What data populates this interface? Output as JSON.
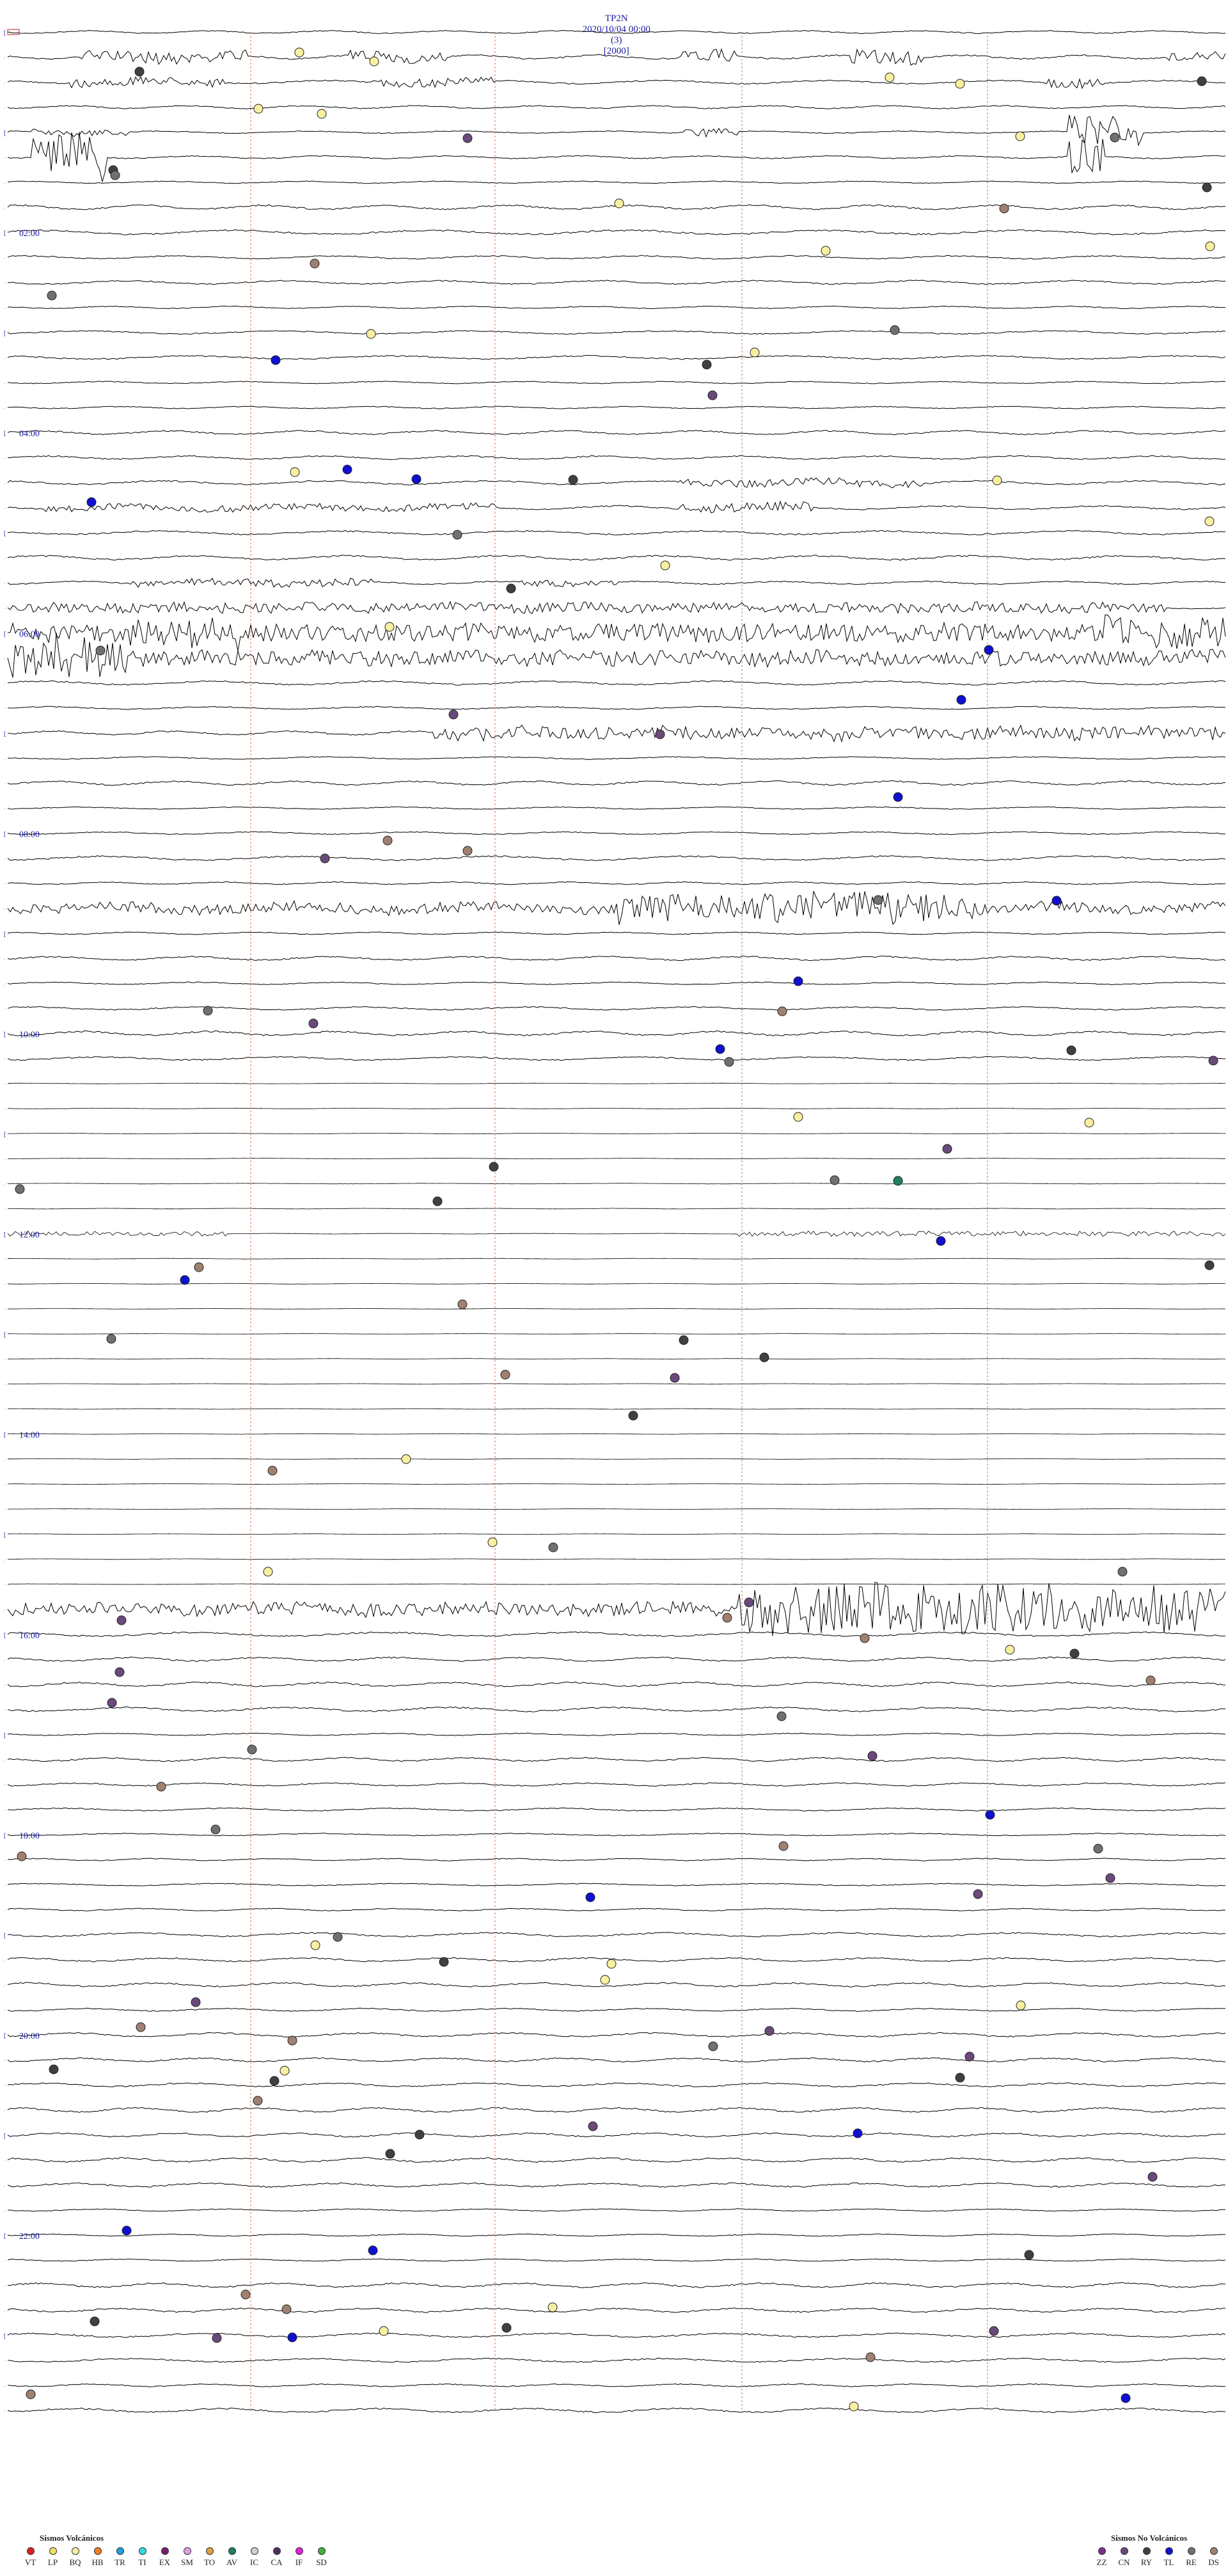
{
  "header": {
    "station": "TP2N",
    "datetime": "2020/10/04 00:00",
    "channel": "(3)",
    "scale": "[2000]"
  },
  "hour_labels": [
    "02:00",
    "04:00",
    "06:00",
    "08:00",
    "10:00",
    "12:00",
    "14:00",
    "16:00",
    "18:00",
    "20:00",
    "22:00"
  ],
  "legend_volcanic": {
    "title": "Sismos Volcánicos",
    "items": [
      {
        "code": "VT",
        "color": "#e02020"
      },
      {
        "code": "LP",
        "color": "#f0e060"
      },
      {
        "code": "BQ",
        "color": "#f8f0a0"
      },
      {
        "code": "HB",
        "color": "#f08020"
      },
      {
        "code": "TR",
        "color": "#20a0e0"
      },
      {
        "code": "TI",
        "color": "#30e0e0"
      },
      {
        "code": "EX",
        "color": "#702070"
      },
      {
        "code": "SM",
        "color": "#e0a0e0"
      },
      {
        "code": "TO",
        "color": "#e0a040"
      },
      {
        "code": "AV",
        "color": "#208060"
      },
      {
        "code": "IC",
        "color": "#d0d0d0"
      },
      {
        "code": "CA",
        "color": "#503060"
      },
      {
        "code": "IF",
        "color": "#e020e0"
      },
      {
        "code": "SD",
        "color": "#40b040"
      }
    ]
  },
  "legend_nonvolcanic": {
    "title": "Sismos No Volcánicos",
    "items": [
      {
        "code": "ZZ",
        "color": "#803090"
      },
      {
        "code": "CN",
        "color": "#6a4a7a"
      },
      {
        "code": "RY",
        "color": "#404040"
      },
      {
        "code": "TL",
        "color": "#1010d0"
      },
      {
        "code": "RE",
        "color": "#707070"
      },
      {
        "code": "DS",
        "color": "#a08070"
      }
    ]
  },
  "colors": {
    "trace": "#000000",
    "hour_marker": "#e06030",
    "hour_label": "#1a1aa0",
    "grid": "#d07a50"
  }
}
